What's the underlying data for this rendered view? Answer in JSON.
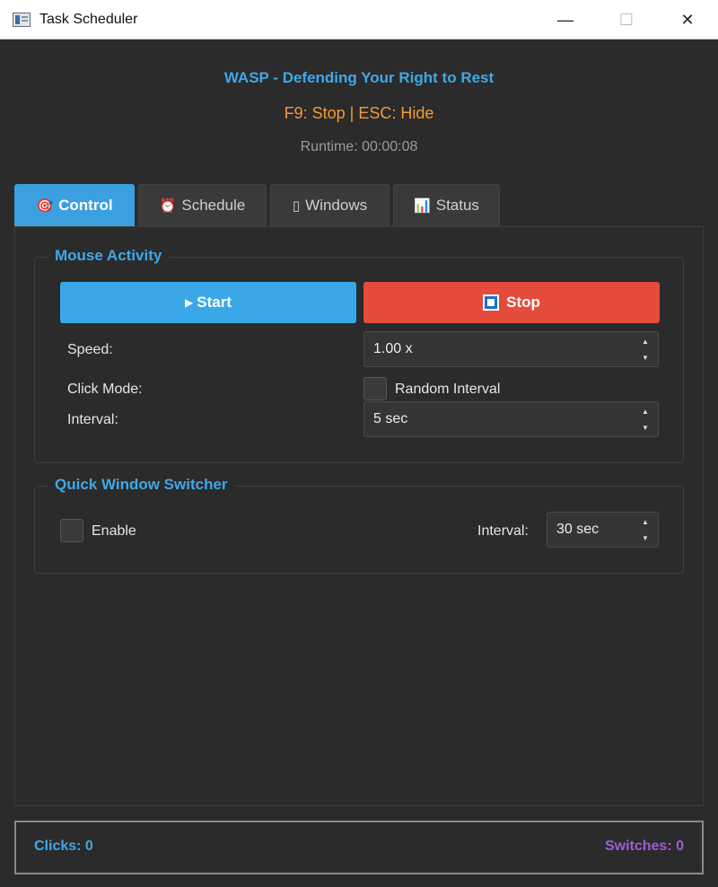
{
  "window": {
    "title": "Task Scheduler",
    "controls": {
      "minimize": "—",
      "maximize": "☐",
      "close": "✕"
    }
  },
  "header": {
    "tagline": "WASP - Defending Your Right to Rest",
    "hotkeys": "F9: Stop | ESC: Hide",
    "runtime": "Runtime: 00:00:08"
  },
  "tabs": [
    {
      "label": "Control",
      "icon": "🎯",
      "icon_name": "target-icon",
      "active": true
    },
    {
      "label": "Schedule",
      "icon": "⏰",
      "icon_name": "alarm-clock-icon",
      "active": false
    },
    {
      "label": "Windows",
      "icon": "▯",
      "icon_name": "window-icon",
      "active": false
    },
    {
      "label": "Status",
      "icon": "📊",
      "icon_name": "bar-chart-icon",
      "active": false
    }
  ],
  "mouse_activity": {
    "title": "Mouse Activity",
    "start_label": "Start",
    "stop_label": "Stop",
    "speed_label": "Speed:",
    "speed_value": "1.00 x",
    "click_mode_label": "Click Mode:",
    "random_interval_label": "Random Interval",
    "random_interval_checked": false,
    "interval_label": "Interval:",
    "interval_value": "5 sec"
  },
  "window_switcher": {
    "title": "Quick Window Switcher",
    "enable_label": "Enable",
    "enable_checked": false,
    "interval_label": "Interval:",
    "interval_value": "30 sec"
  },
  "footer": {
    "clicks": "Clicks: 0",
    "switches": "Switches: 0"
  },
  "colors": {
    "accent": "#3aa8e8",
    "stop": "#e54b3c",
    "hotkey": "#f39c33",
    "switches": "#a25ad6",
    "background": "#2b2b2b"
  }
}
